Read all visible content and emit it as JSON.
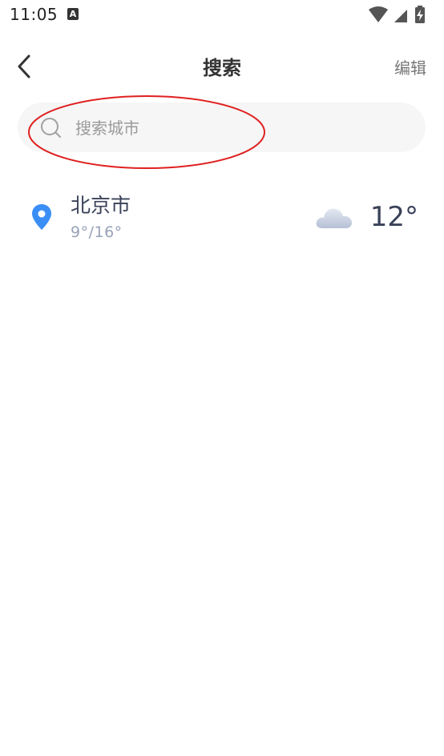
{
  "status_bar": {
    "time": "11:05",
    "notification_icon_letter": "A",
    "icons": [
      "wifi-icon",
      "signal-icon",
      "battery-charging-icon"
    ]
  },
  "header": {
    "title": "搜索",
    "edit_label": "编辑",
    "back_icon": "chevron-left-icon"
  },
  "search": {
    "placeholder": "搜索城市",
    "value": "",
    "icon": "search-icon"
  },
  "annotation": {
    "type": "ellipse",
    "color": "#e02020"
  },
  "cities": [
    {
      "name": "北京市",
      "range": "9°/16°",
      "temperature": "12°",
      "weather_icon": "cloud-icon",
      "location_icon": "location-pin-icon"
    }
  ],
  "colors": {
    "pin": "#3b8ef6",
    "city_text": "#3a4259",
    "range_text": "#98a2b8",
    "search_bg": "#f6f6f6"
  }
}
